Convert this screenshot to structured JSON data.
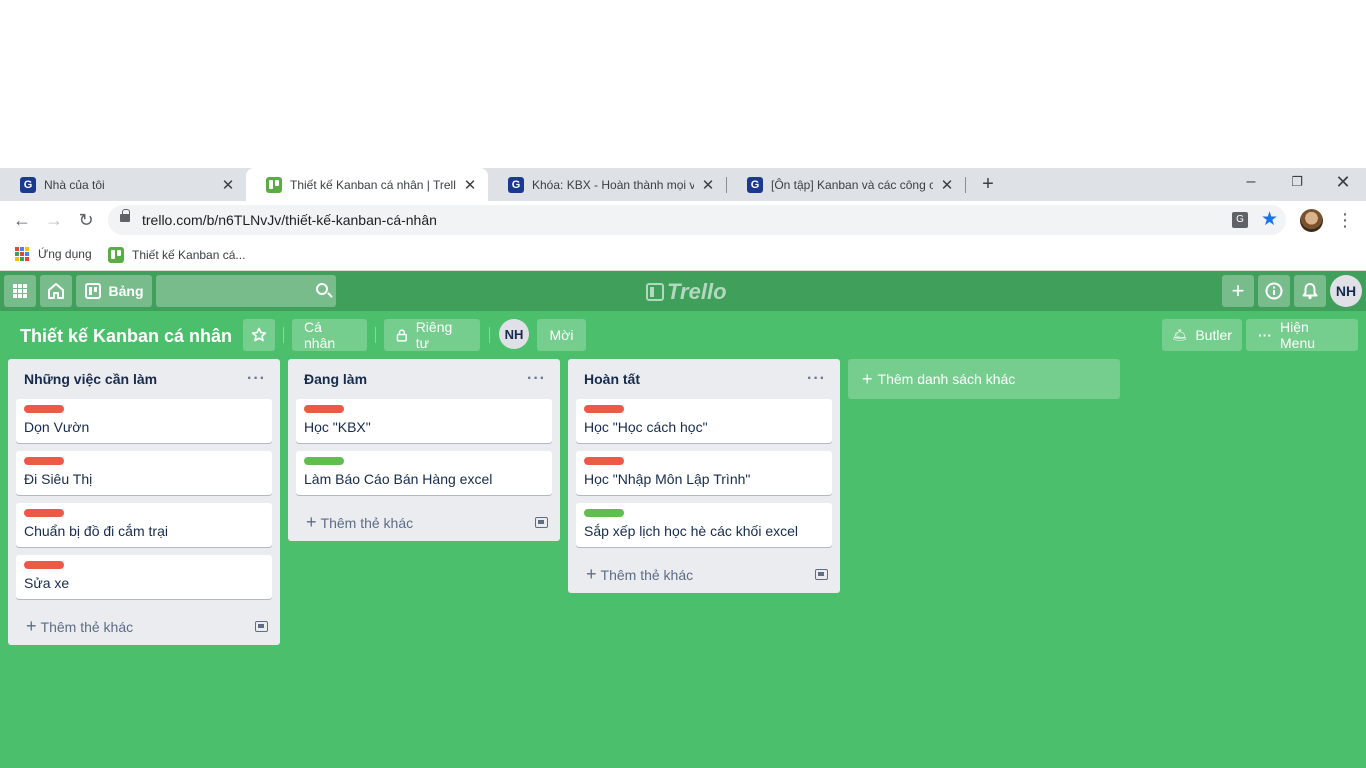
{
  "browser": {
    "tabs": [
      {
        "title": "Nhà của tôi"
      },
      {
        "title": "Thiết kế Kanban cá nhân | Trello"
      },
      {
        "title": "Khóa: KBX - Hoàn thành mọi việc"
      },
      {
        "title": "[Ôn tập] Kanban và các công cụ h"
      }
    ],
    "url": "trello.com/b/n6TLNvJv/thiết-kế-kanban-cá-nhân",
    "bookmarks": {
      "apps": "Ứng dụng",
      "board": "Thiết kế Kanban cá..."
    },
    "favicon_g_letter": "G"
  },
  "header": {
    "boards_label": "Bảng",
    "logo_text": "Trello",
    "user_initials": "NH"
  },
  "board": {
    "title": "Thiết kế Kanban cá nhân",
    "team_label": "Cá nhân",
    "visibility_label": "Riêng tư",
    "member_initials": "NH",
    "invite_label": "Mời",
    "butler_label": "Butler",
    "menu_label": "Hiện Menu",
    "add_list_label": "Thêm danh sách khác",
    "add_card_label": "Thêm thẻ khác",
    "list_menu": "···"
  },
  "colors": {
    "red_label": "#eb5a46",
    "green_label": "#61bd4f",
    "board_bg": "#4bbf6b"
  },
  "lists": [
    {
      "title": "Những việc cần làm",
      "cards": [
        {
          "label": "red",
          "text": "Dọn Vườn"
        },
        {
          "label": "red",
          "text": "Đi Siêu Thị"
        },
        {
          "label": "red",
          "text": "Chuẩn bị đồ đi cắm trại"
        },
        {
          "label": "red",
          "text": "Sửa xe"
        }
      ]
    },
    {
      "title": "Đang làm",
      "cards": [
        {
          "label": "red",
          "text": "Học \"KBX\""
        },
        {
          "label": "green",
          "text": "Làm Báo Cáo Bán Hàng excel"
        }
      ]
    },
    {
      "title": "Hoàn tất",
      "cards": [
        {
          "label": "red",
          "text": "Học \"Học cách học\""
        },
        {
          "label": "red",
          "text": "Học \"Nhập Môn Lập Trình\""
        },
        {
          "label": "green",
          "text": "Sắp xếp lịch học hè các khối excel"
        }
      ]
    }
  ]
}
